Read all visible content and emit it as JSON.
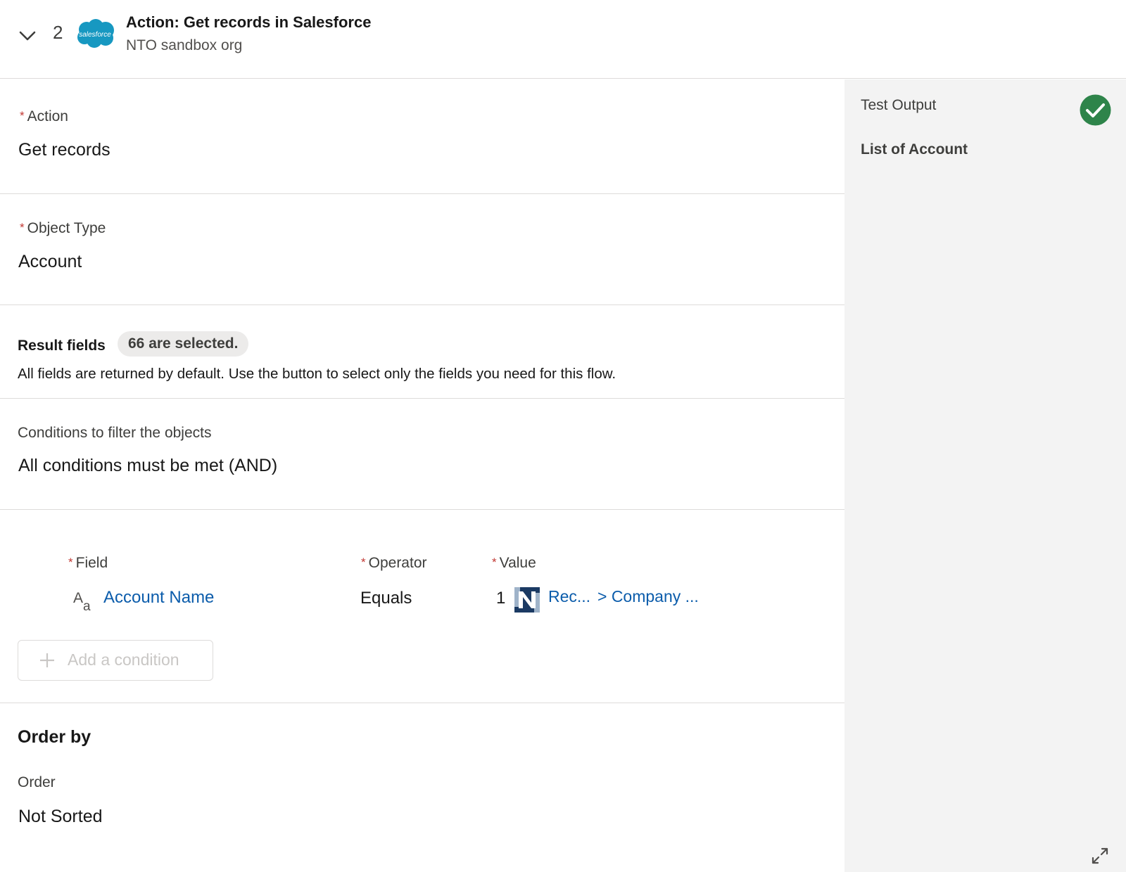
{
  "header": {
    "step_number": "2",
    "app_logo_text": "salesforce",
    "title": "Action: Get records in Salesforce",
    "subtitle": "NTO sandbox org"
  },
  "required_marker": "*",
  "action": {
    "label": "Action",
    "value": "Get records"
  },
  "object_type": {
    "label": "Object Type",
    "value": "Account"
  },
  "result_fields": {
    "label": "Result fields",
    "badge": "66 are selected.",
    "help": "All fields are returned by default. Use the button to select only the fields you need for this flow."
  },
  "conditions": {
    "label": "Conditions to filter the objects",
    "value": "All conditions must be met (AND)",
    "columns": {
      "field": "Field",
      "operator": "Operator",
      "value": "Value"
    },
    "rows": [
      {
        "field_icon": "text-type-icon",
        "field": "Account Name",
        "operator": "Equals",
        "index": "1",
        "value_icon": "netsuite-icon",
        "value_part1": "Rec...",
        "value_part2": "> Company ..."
      }
    ],
    "add_button": "Add a condition"
  },
  "order_by": {
    "title": "Order by",
    "label": "Order",
    "value": "Not Sorted"
  },
  "side_panel": {
    "label": "Test Output",
    "status_icon": "success-check-icon",
    "value": "List of Account",
    "colors": {
      "background": "#f3f3f3",
      "success": "#2e844a"
    }
  },
  "colors": {
    "link": "#0b5cab",
    "brand": "#1798c1",
    "required": "#c23934",
    "netsuite": "#1b3a63"
  }
}
